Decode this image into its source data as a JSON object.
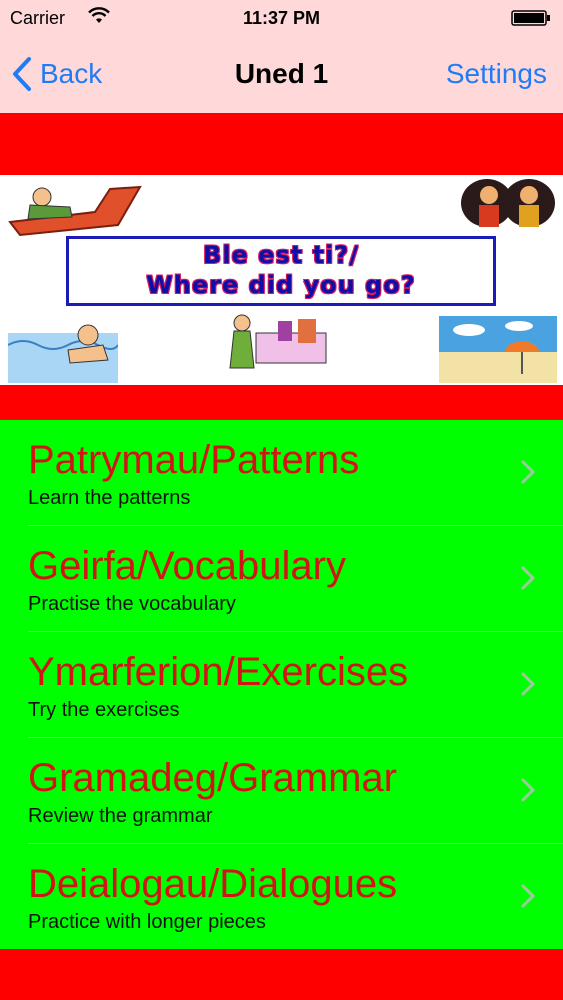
{
  "status_bar": {
    "carrier": "Carrier",
    "time": "11:37 PM"
  },
  "nav": {
    "back_label": "Back",
    "title": "Uned 1",
    "settings_label": "Settings"
  },
  "banner": {
    "line1": "Ble est ti?/",
    "line2": "Where did you go?"
  },
  "menu": [
    {
      "title": "Patrymau/Patterns",
      "subtitle": "Learn the patterns"
    },
    {
      "title": "Geirfa/Vocabulary",
      "subtitle": "Practise the vocabulary"
    },
    {
      "title": "Ymarferion/Exercises",
      "subtitle": "Try the exercises"
    },
    {
      "title": "Gramadeg/Grammar",
      "subtitle": "Review the grammar"
    },
    {
      "title": "Deialogau/Dialogues",
      "subtitle": "Practice with longer pieces"
    }
  ],
  "colors": {
    "topbar": "#ffd9d9",
    "accent_blue": "#1f7cf6",
    "page_red": "#ff0000",
    "menu_green": "#00ff00",
    "title_red": "#d11515"
  }
}
